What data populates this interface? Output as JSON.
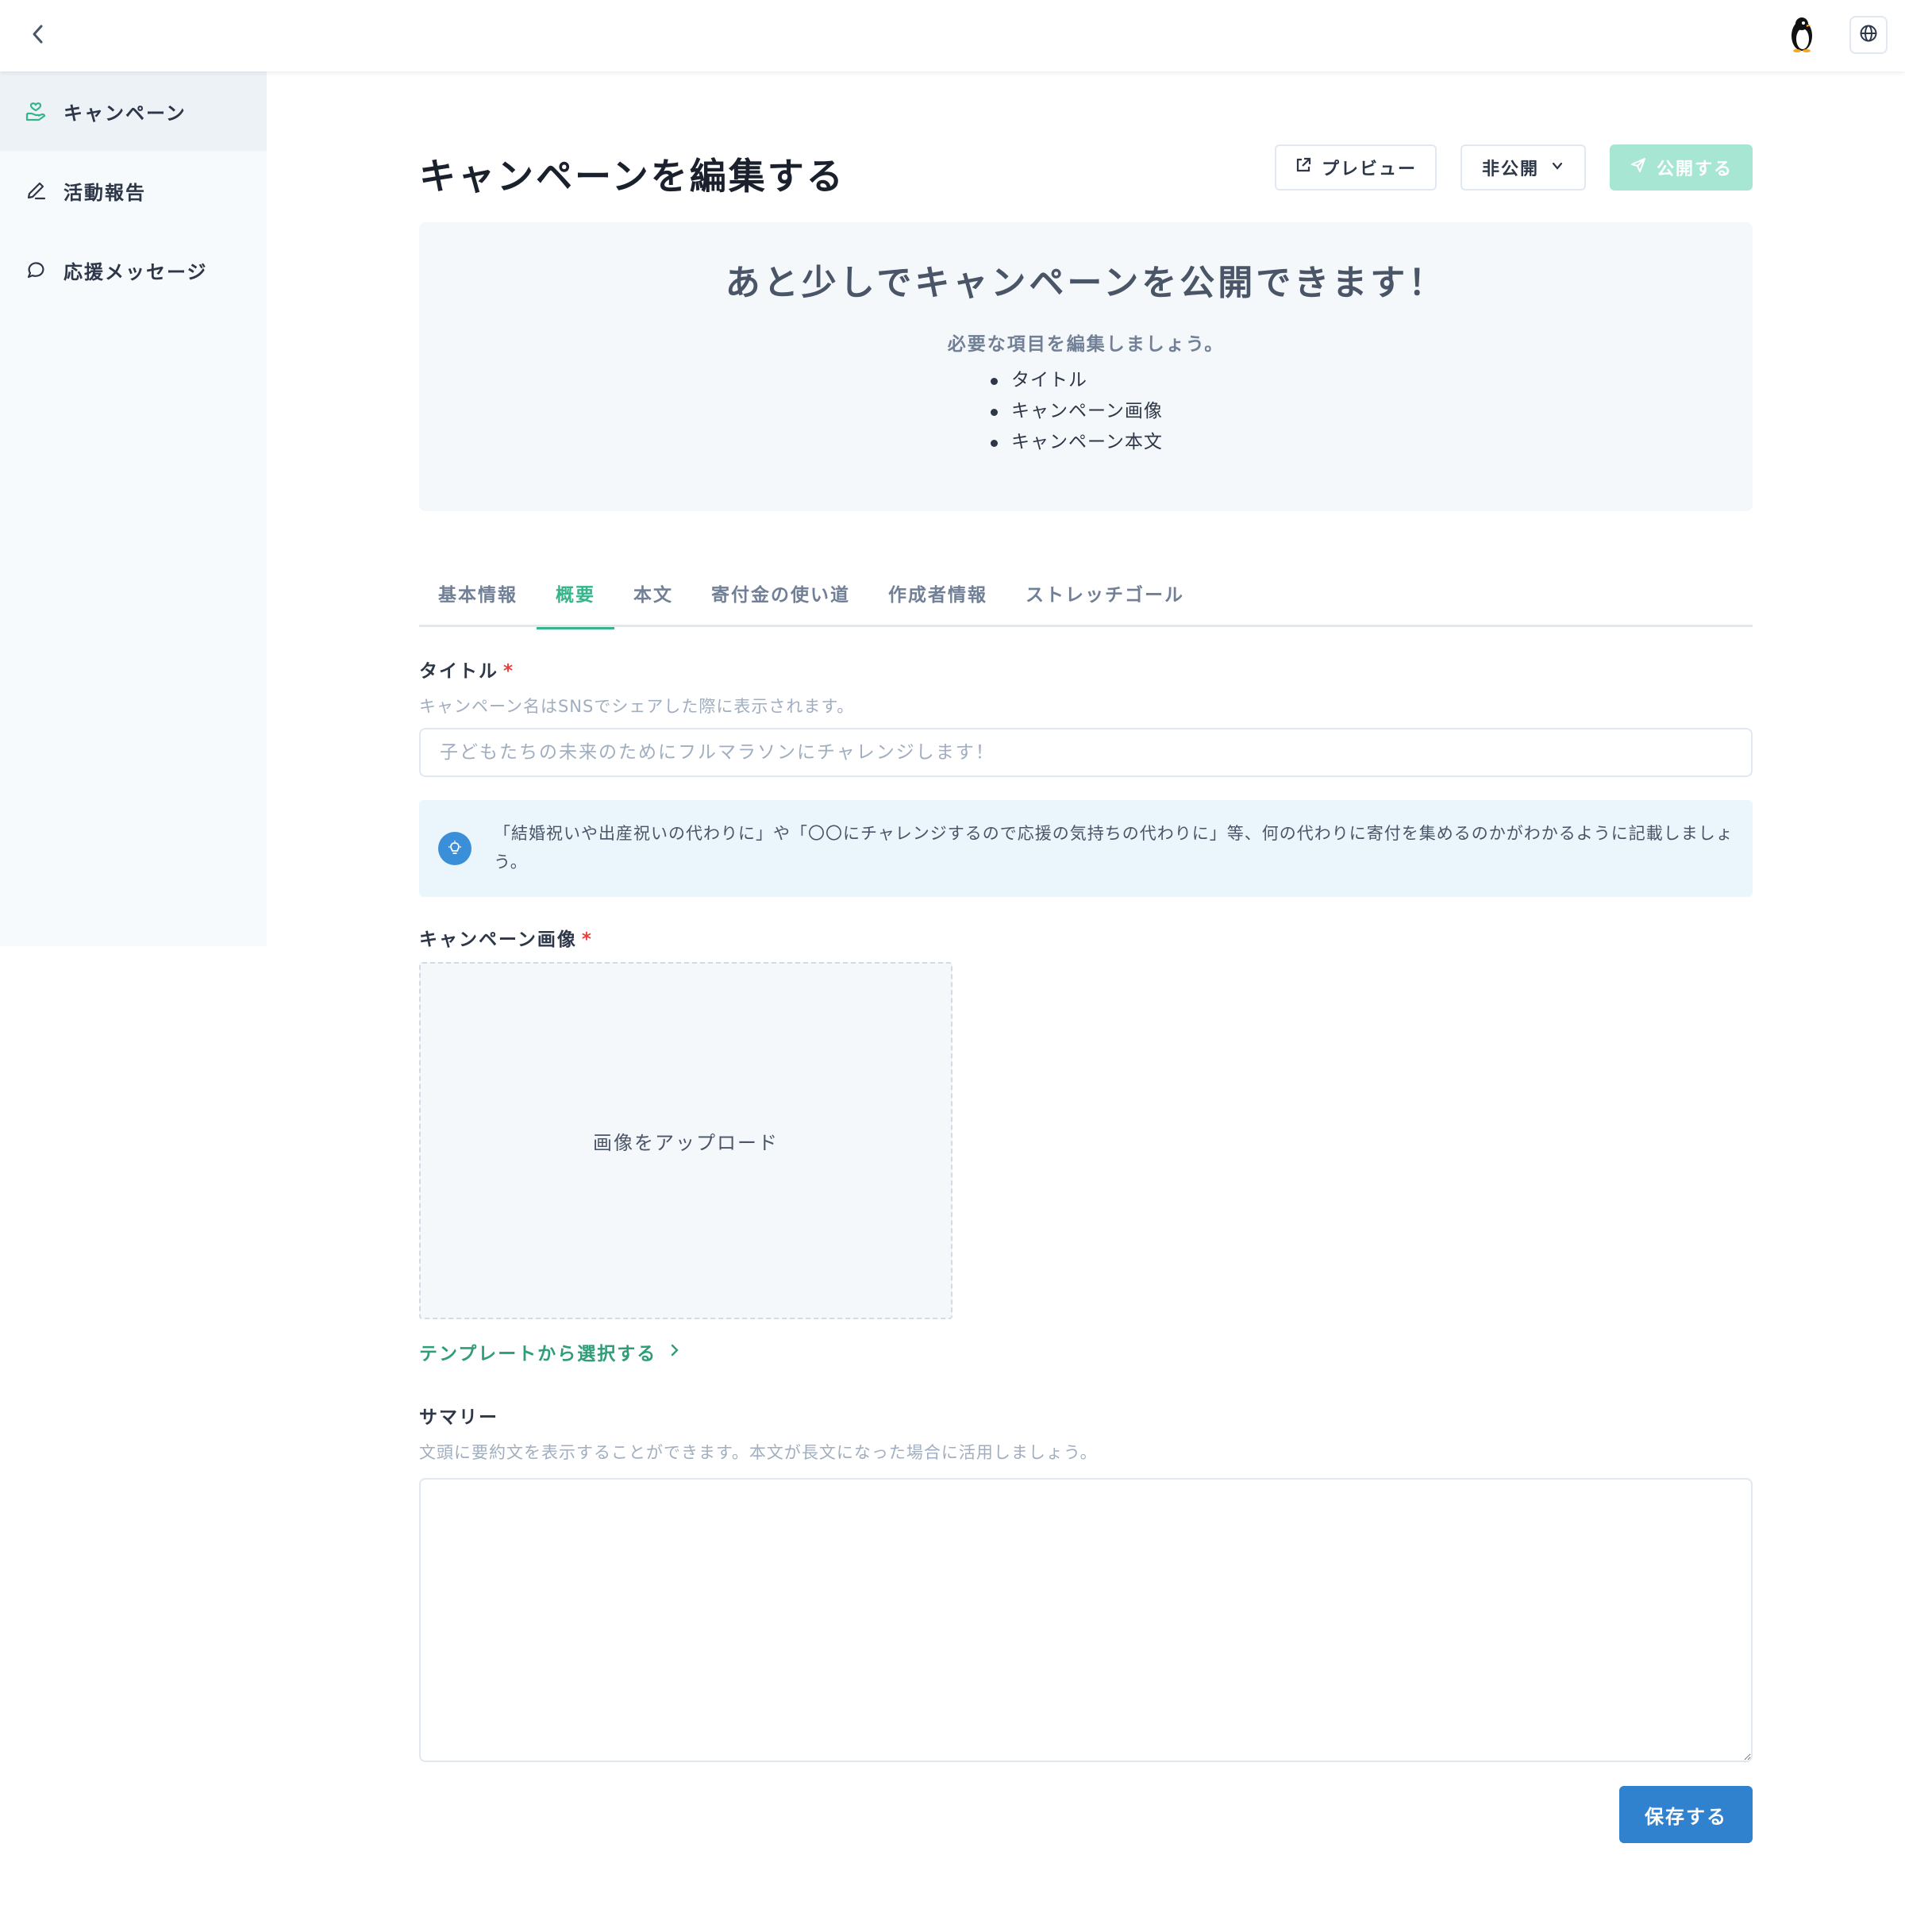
{
  "header": {
    "back_icon": "chevron-left-icon",
    "avatar_icon": "penguin-avatar",
    "language_icon": "globe-icon"
  },
  "sidebar": {
    "items": [
      {
        "label": "キャンペーン",
        "icon": "hand-heart-icon",
        "active": true
      },
      {
        "label": "活動報告",
        "icon": "pencil-icon",
        "active": false
      },
      {
        "label": "応援メッセージ",
        "icon": "message-circle-icon",
        "active": false
      }
    ]
  },
  "main": {
    "page_title": "キャンペーンを編集する",
    "actions": {
      "preview_label": "プレビュー",
      "status_label": "非公開",
      "publish_label": "公開する"
    },
    "notice": {
      "heading": "あと少しでキャンペーンを公開できます！",
      "subheading": "必要な項目を編集しましょう。",
      "items": [
        "タイトル",
        "キャンペーン画像",
        "キャンペーン本文"
      ]
    },
    "tabs": [
      {
        "label": "基本情報",
        "active": false
      },
      {
        "label": "概要",
        "active": true
      },
      {
        "label": "本文",
        "active": false
      },
      {
        "label": "寄付金の使い道",
        "active": false
      },
      {
        "label": "作成者情報",
        "active": false
      },
      {
        "label": "ストレッチゴール",
        "active": false
      }
    ],
    "title_field": {
      "label": "タイトル",
      "required_mark": "*",
      "help": "キャンペーン名はSNSでシェアした際に表示されます。",
      "placeholder": "子どもたちの未来のためにフルマラソンにチャレンジします！",
      "value": ""
    },
    "hint": {
      "icon": "lightbulb-icon",
      "text": "「結婚祝いや出産祝いの代わりに」や「〇〇にチャレンジするので応援の気持ちの代わりに」等、何の代わりに寄付を集めるのかがわかるように記載しましょう。"
    },
    "image_field": {
      "label": "キャンペーン画像",
      "required_mark": "*",
      "upload_label": "画像をアップロード",
      "template_link": "テンプレートから選択する"
    },
    "summary_field": {
      "label": "サマリー",
      "help": "文頭に要約文を表示することができます。本文が長文になった場合に活用しましょう。",
      "value": ""
    },
    "save_label": "保存する"
  },
  "colors": {
    "accent": "#38b48b",
    "publish_disabled": "#a8e6d4",
    "save_button": "#3182ce",
    "hint_background": "#ebf5fc",
    "required": "#e53e3e"
  }
}
